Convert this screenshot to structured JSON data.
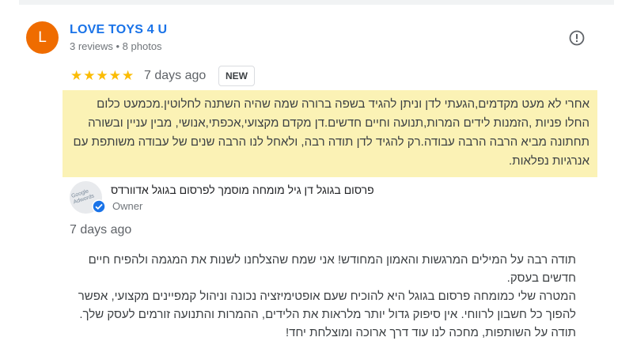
{
  "review": {
    "author_initial": "L",
    "author_name": "LOVE TOYS 4 U",
    "author_meta": "3 reviews • 8 photos",
    "stars": "★★★★★",
    "rating": 5,
    "date": "7 days ago",
    "badge": "NEW",
    "text": "אחרי לא מעט מקדמים,הגעתי לדן וניתן להגיד בשפה ברורה שמה שהיה השתנה לחלוטין.מכמעט כלום החלו פניות ,הזמנות לידים המרות,תנועה וחיים חדשים.דן מקדם מקצועי,אכפתי,אנושי, מבין עניין ובשורה תחתונה מביא הרבה הרבה עבודה.רק להגיד לדן תודה רבה, ולאחל לנו הרבה שנים של עבודה משותפת עם אנרגיות נפלאות."
  },
  "owner_reply": {
    "owner_name": "פרסום בגוגל דן גיל מומחה מוסמך לפרסום בגוגל אדוורדס",
    "role": "Owner",
    "logo_text": "Google Adwords",
    "date": "7 days ago",
    "text": "תודה רבה על המילים המרגשות והאמון המחודש! אני שמח שהצלחנו לשנות את המגמה ולהפיח חיים חדשים בעסק.\nהמטרה שלי כמומחה פרסום בגוגל היא להוכיח שעם אופטימיזציה נכונה וניהול קמפיינים מקצועי, אפשר להפוך כל חשבון לרווחי. אין סיפוק גדול יותר מלראות את הלידים, ההמרות והתנועה זורמים לעסק שלך.\nתודה על השותפות, מחכה לנו עוד דרך ארוכה ומוצלחת יחד!"
  },
  "icons": {
    "flag": "report-flag-icon",
    "verified": "verified-check-icon"
  },
  "colors": {
    "avatar": "#ef6c00",
    "author_link": "#1a73e8",
    "stars": "#fbbc04",
    "highlight": "#fbf2b5"
  }
}
